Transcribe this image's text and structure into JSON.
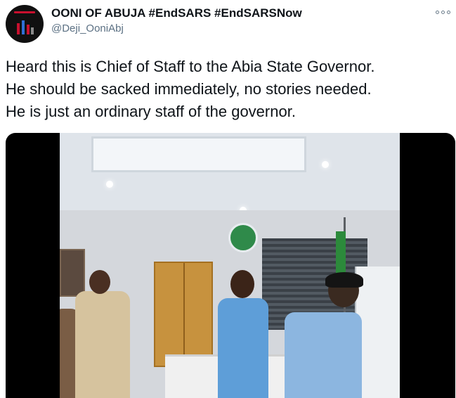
{
  "tweet": {
    "display_name": "OONI OF ABUJA #EndSARS #EndSARSNow",
    "handle": "@Deji_OoniAbj",
    "more_icon": "more-options-icon",
    "text_lines": [
      "Heard this is Chief of Staff to the Abia State Governor.",
      "He should be sacked immediately, no stories needed.",
      "He is just an ordinary staff of the governor."
    ]
  },
  "colors": {
    "text": "#0f1419",
    "secondary_text": "#5b7083",
    "media_background": "#000000"
  }
}
